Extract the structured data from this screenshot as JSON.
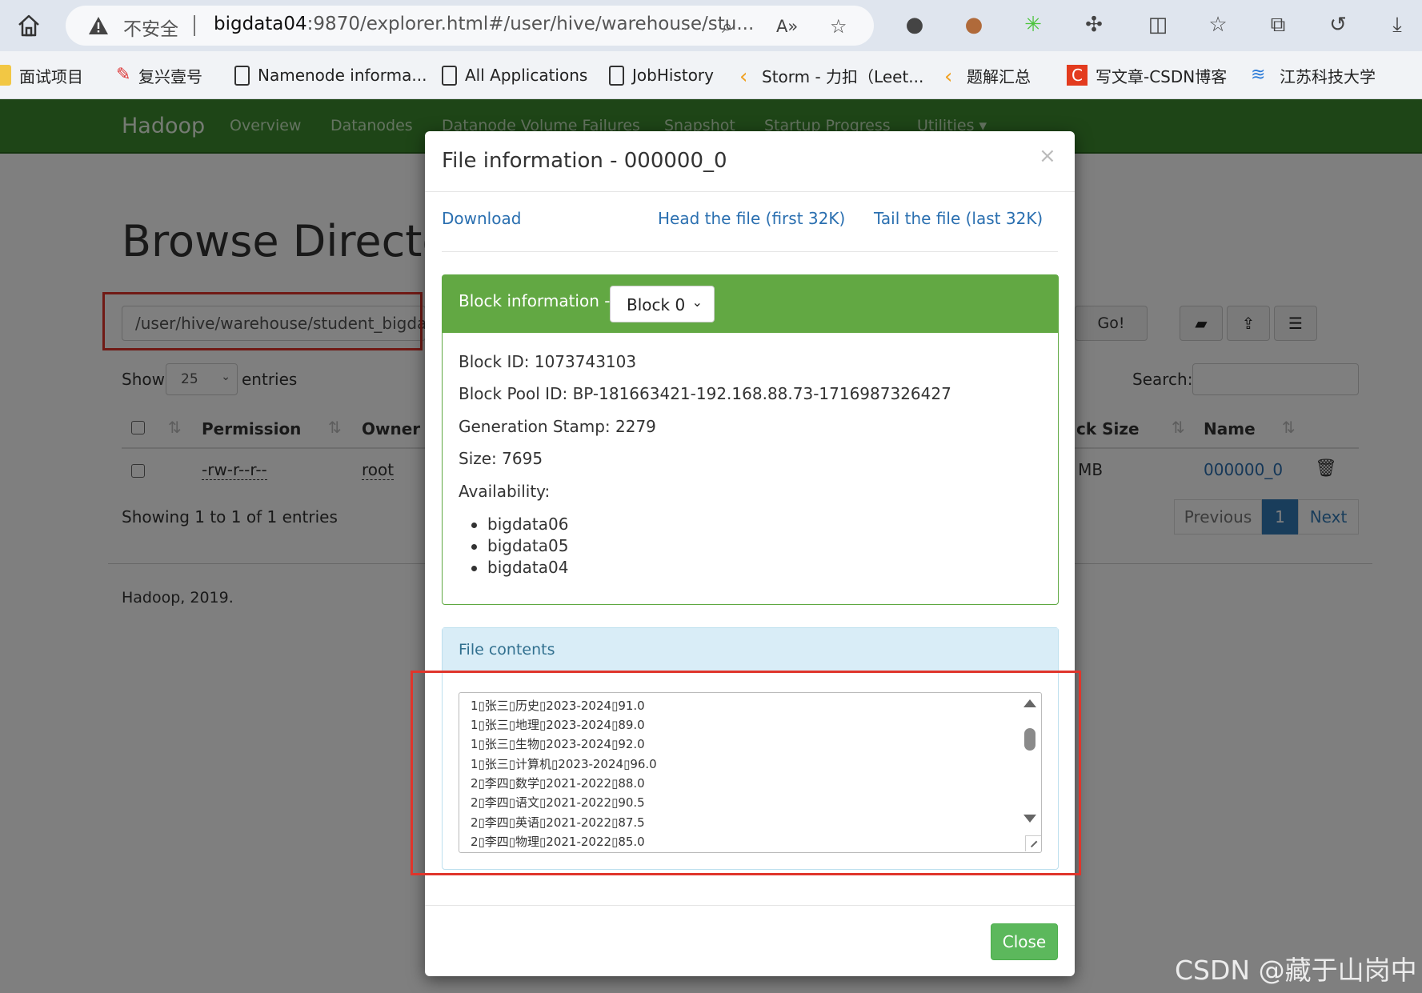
{
  "browser": {
    "insecure_label": "不安全",
    "url_host": "bigdata04",
    "url_rest": ":9870/explorer.html#/user/hive/warehouse/stu...",
    "bookmarks": [
      {
        "label": "面试项目"
      },
      {
        "label": "复兴壹号"
      },
      {
        "label": "Namenode informa..."
      },
      {
        "label": "All Applications"
      },
      {
        "label": "JobHistory"
      },
      {
        "label": "Storm - 力扣（Leet..."
      },
      {
        "label": "题解汇总"
      },
      {
        "label": "写文章-CSDN博客"
      },
      {
        "label": "江苏科技大学"
      }
    ]
  },
  "navbar": {
    "brand": "Hadoop",
    "items": [
      "Overview",
      "Datanodes",
      "Datanode Volume Failures",
      "Snapshot",
      "Startup Progress",
      "Utilities ▾"
    ]
  },
  "browse": {
    "title": "Browse Directory",
    "path": "/user/hive/warehouse/student_bigdata",
    "go_label": "Go!",
    "show_label": "Show",
    "entries_value": "25",
    "entries_label": "entries",
    "search_label": "Search:",
    "columns": {
      "permission": "Permission",
      "owner": "Owner",
      "block_size": "ck Size",
      "name": "Name"
    },
    "row": {
      "permission": "-rw-r--r--",
      "owner": "root",
      "block_size": "3 MB",
      "name": "000000_0"
    },
    "showing": "Showing 1 to 1 of 1 entries",
    "pager": {
      "prev": "Previous",
      "page": "1",
      "next": "Next"
    },
    "footer": "Hadoop, 2019."
  },
  "modal": {
    "title": "File information - 000000_0",
    "close_x": "×",
    "links": {
      "download": "Download",
      "head": "Head the file (first 32K)",
      "tail": "Tail the file (last 32K)"
    },
    "block_header": "Block information --",
    "block_select": "Block 0",
    "block_id": "Block ID: 1073743103",
    "block_pool": "Block Pool ID: BP-181663421-192.168.88.73-1716987326427",
    "generation": "Generation Stamp: 2279",
    "size": "Size: 7695",
    "availability_label": "Availability:",
    "availability": [
      "bigdata06",
      "bigdata05",
      "bigdata04"
    ],
    "contents_header": "File contents",
    "contents_lines": [
      "1\u0001张三\u0001历史\u00012023-2024\u000191.0",
      "1\u0001张三\u0001地理\u00012023-2024\u000189.0",
      "1\u0001张三\u0001生物\u00012023-2024\u000192.0",
      "1\u0001张三\u0001计算机\u00012023-2024\u000196.0",
      "2\u0001李四\u0001数学\u00012021-2022\u000188.0",
      "2\u0001李四\u0001语文\u00012021-2022\u000190.5",
      "2\u0001李四\u0001英语\u00012021-2022\u000187.5",
      "2\u0001李四\u0001物理\u00012021-2022\u000185.0"
    ],
    "close_label": "Close"
  },
  "watermark": "CSDN @藏于山岗中",
  "colors": {
    "navbar": "#3d8b2f",
    "block_header": "#62a843",
    "link": "#2a6fb0",
    "highlight": "#e0352b",
    "close_button": "#5cb85c"
  }
}
